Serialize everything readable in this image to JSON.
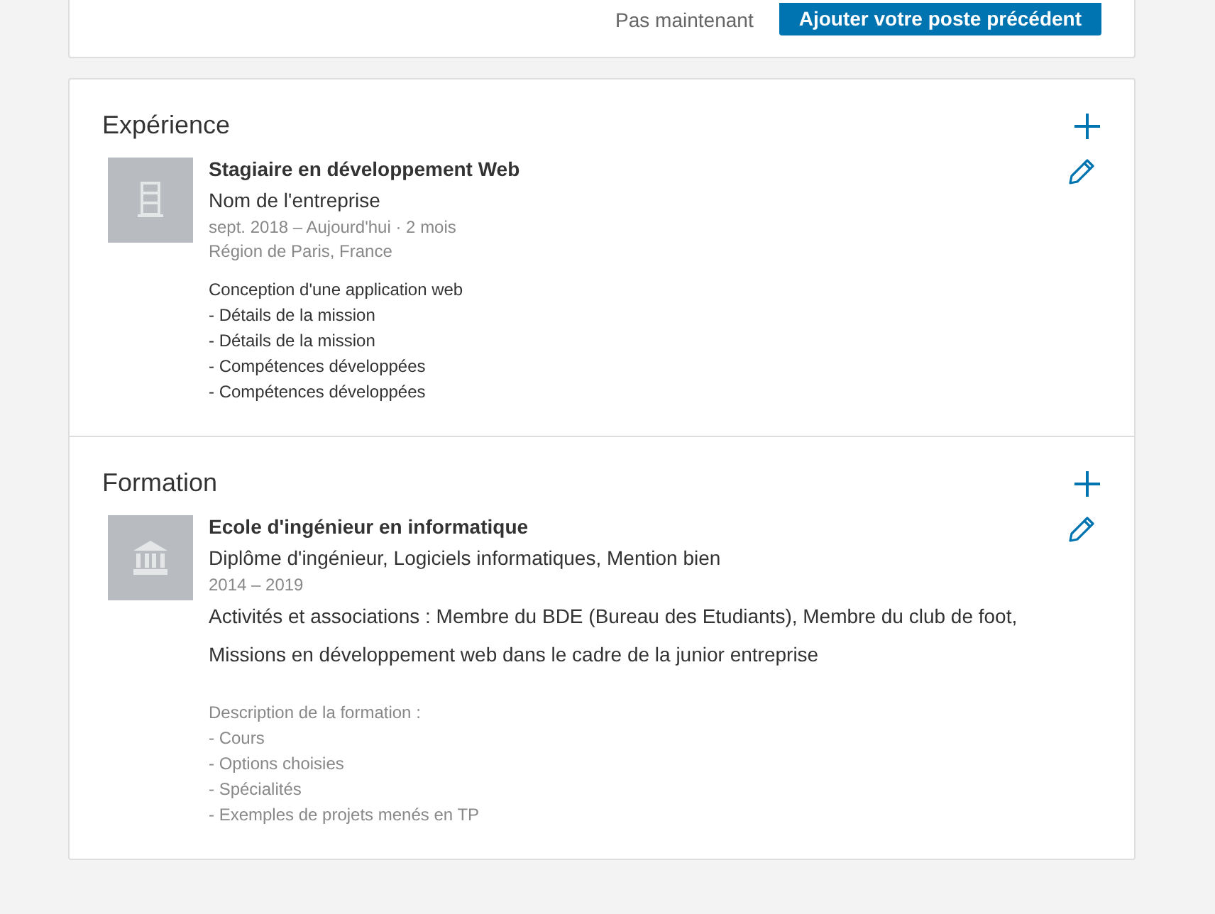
{
  "top_card": {
    "secondary_action": "Pas maintenant",
    "primary_action": "Ajouter votre poste précédent"
  },
  "sections": [
    {
      "title": "Expérience",
      "entries": [
        {
          "kind": "company",
          "title": "Stagiaire en développement Web",
          "subtitle": "Nom de l'entreprise",
          "meta": [
            "sept. 2018 – Aujourd'hui · 2 mois",
            "Région de Paris, France"
          ],
          "description": [
            "Conception d'une application web",
            "- Détails de la mission",
            "- Détails de la mission",
            "- Compétences développées",
            "- Compétences développées"
          ]
        }
      ]
    },
    {
      "title": "Formation",
      "entries": [
        {
          "kind": "school",
          "title": "Ecole d'ingénieur en informatique",
          "subtitle": "Diplôme d'ingénieur, Logiciels informatiques, Mention bien",
          "meta": [
            "2014 – 2019"
          ],
          "activities": "Activités et associations : Membre du BDE (Bureau des Etudiants), Membre du club de foot, Missions en développement web dans le cadre de la junior entreprise",
          "description": [
            "Description de la formation :",
            "- Cours",
            "- Options choisies",
            "- Spécialités",
            "- Exemples de projets menés en TP"
          ]
        }
      ]
    }
  ]
}
